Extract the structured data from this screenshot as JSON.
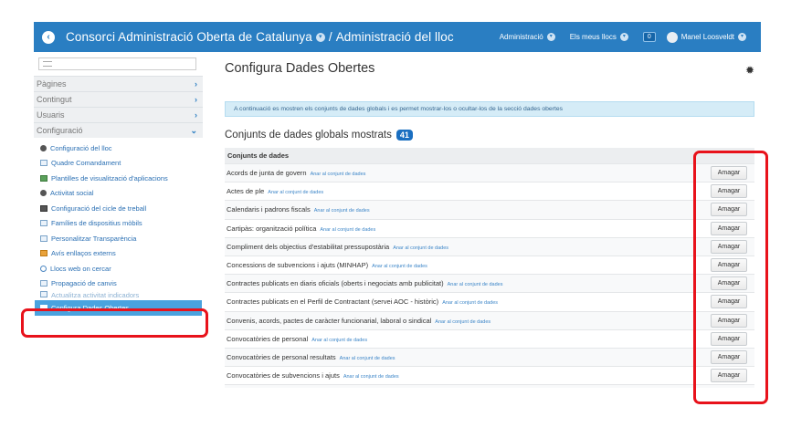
{
  "header": {
    "site_title": "Consorci Administració Oberta de Catalunya",
    "separator": "/",
    "section_title": "Administració del lloc",
    "menus": [
      {
        "label": "Administració"
      },
      {
        "label": "Els meus llocs"
      }
    ],
    "notification_count": "0",
    "user_name": "Manel Loosveldt"
  },
  "sidebar": {
    "sections": [
      {
        "label": "Pàgines",
        "chevron": "›"
      },
      {
        "label": "Contingut",
        "chevron": "›"
      },
      {
        "label": "Usuaris",
        "chevron": "›"
      },
      {
        "label": "Configuració",
        "chevron": "⌄"
      }
    ],
    "items": [
      {
        "label": "Configuració del lloc",
        "icon": "gear-icon"
      },
      {
        "label": "Quadre Comandament",
        "icon": "panel-icon"
      },
      {
        "label": "Plantilles de visualització d'aplicacions",
        "icon": "templates-icon"
      },
      {
        "label": "Activitat social",
        "icon": "social-icon"
      },
      {
        "label": "Configuració del cicle de treball",
        "icon": "workflow-icon"
      },
      {
        "label": "Famílies de dispositius mòbils",
        "icon": "mobile-icon"
      },
      {
        "label": "Personalitzar Transparència",
        "icon": "panel-icon"
      },
      {
        "label": "Avís enllaços externs",
        "icon": "warning-icon"
      },
      {
        "label": "Llocs web on cercar",
        "icon": "search-icon"
      },
      {
        "label": "Propagació de canvis",
        "icon": "panel-icon"
      },
      {
        "label": "Actualitza activitat indicadors",
        "icon": "panel-icon"
      },
      {
        "label": "Configura Dades Obertes",
        "icon": "open-data-icon"
      }
    ]
  },
  "main": {
    "page_title": "Configura Dades Obertes",
    "info_text": "A continuació es mostren els conjunts de dades globals i es permet mostrar-los o ocultar-los de la secció dades obertes",
    "section_title": "Conjunts de dades globals mostrats",
    "section_count": "41",
    "table_header": "Conjunts de dades",
    "link_label": "Anar al conjunt de dades",
    "button_label": "Amagar",
    "rows": [
      {
        "name": "Acords de junta de govern"
      },
      {
        "name": "Actes de ple"
      },
      {
        "name": "Calendaris i padrons fiscals"
      },
      {
        "name": "Cartipàs: organització política"
      },
      {
        "name": "Compliment dels objectius d'estabilitat pressupostària"
      },
      {
        "name": "Concessions de subvencions i ajuts (MINHAP)"
      },
      {
        "name": "Contractes publicats en diaris oficials (oberts i negociats amb publicitat)"
      },
      {
        "name": "Contractes publicats en el Perfil de Contractant (servei AOC - històric)"
      },
      {
        "name": "Convenis, acords, pactes de caràcter funcionarial, laboral o sindical"
      },
      {
        "name": "Convocatòries de personal"
      },
      {
        "name": "Convocatòries de personal resultats"
      },
      {
        "name": "Convocatòries de subvencions i ajuts"
      }
    ]
  },
  "colors": {
    "header_bg": "#2a7ec2",
    "link": "#2a6fb3",
    "active_item": "#4aa3df",
    "highlight": "#e8121b",
    "badge": "#1a6fc1"
  }
}
